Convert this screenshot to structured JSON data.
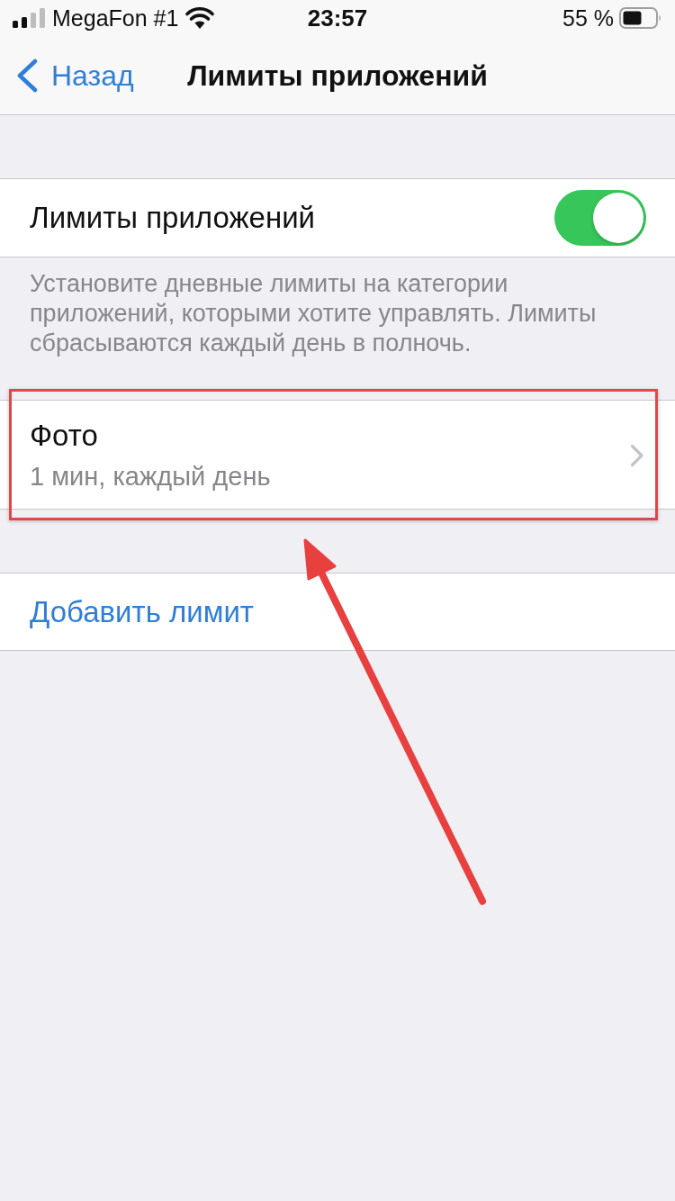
{
  "status_bar": {
    "carrier": "MegaFon #1",
    "time": "23:57",
    "battery": "55 %"
  },
  "nav": {
    "back": "Назад",
    "title": "Лимиты приложений"
  },
  "toggle_row": {
    "label": "Лимиты приложений",
    "on": true
  },
  "footer": "Установите дневные лимиты на категории приложений, которыми хотите управлять. Лимиты сбрасываются каждый день в полночь.",
  "limits": [
    {
      "title": "Фото",
      "detail": "1 мин, каждый день",
      "highlighted": true
    }
  ],
  "add_button": "Добавить лимит",
  "annotations": [
    {
      "kind": "arrow"
    }
  ]
}
